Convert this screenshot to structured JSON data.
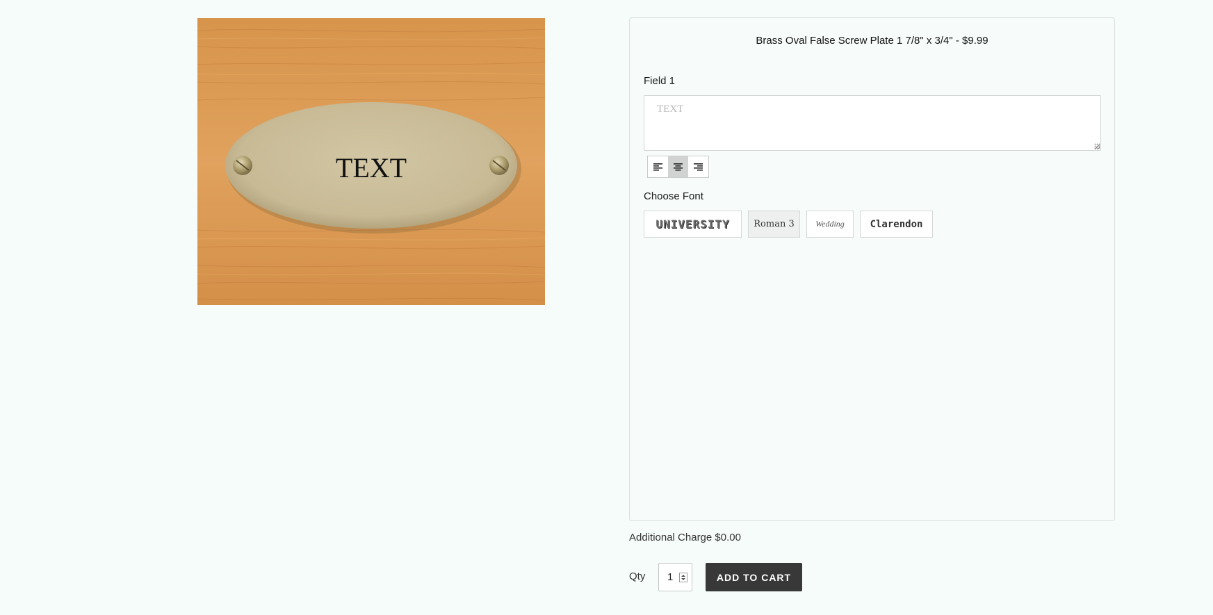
{
  "preview": {
    "plate_text": "TEXT",
    "wood_color": "#d99a52",
    "plate_color": "#c9bc99"
  },
  "product": {
    "title": "Brass Oval False Screw Plate 1 7/8\" x 3/4\" - $9.99"
  },
  "field": {
    "label": "Field 1",
    "placeholder": "TEXT",
    "value": ""
  },
  "alignment": {
    "options": [
      "align-left",
      "align-center",
      "align-right"
    ],
    "selected": "align-center"
  },
  "fonts": {
    "label": "Choose Font",
    "options": [
      "UNIVERSITY",
      "Roman 3",
      "Wedding",
      "Clarendon"
    ],
    "selected": "Roman 3"
  },
  "charge": {
    "text": "Additional Charge $0.00"
  },
  "cart": {
    "qty_label": "Qty",
    "qty_value": "1",
    "add_label": "ADD TO CART",
    "button_color": "#383838"
  }
}
